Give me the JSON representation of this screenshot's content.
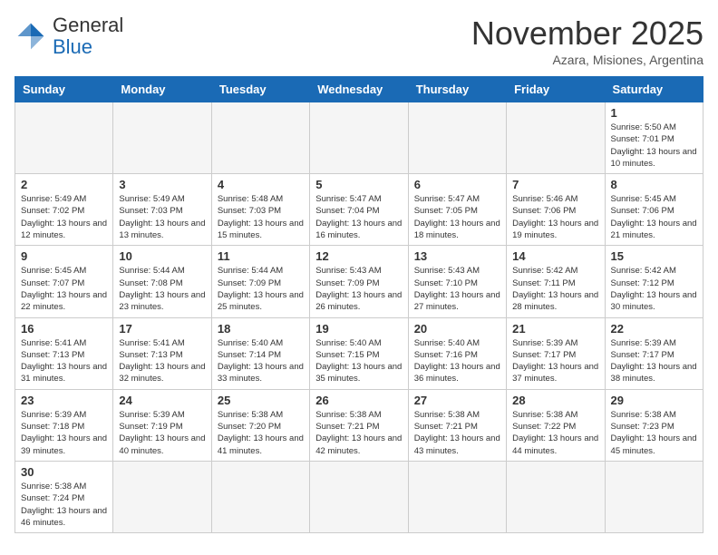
{
  "header": {
    "logo_general": "General",
    "logo_blue": "Blue",
    "month_title": "November 2025",
    "subtitle": "Azara, Misiones, Argentina"
  },
  "days_of_week": [
    "Sunday",
    "Monday",
    "Tuesday",
    "Wednesday",
    "Thursday",
    "Friday",
    "Saturday"
  ],
  "weeks": [
    [
      {
        "day": "",
        "info": ""
      },
      {
        "day": "",
        "info": ""
      },
      {
        "day": "",
        "info": ""
      },
      {
        "day": "",
        "info": ""
      },
      {
        "day": "",
        "info": ""
      },
      {
        "day": "",
        "info": ""
      },
      {
        "day": "1",
        "info": "Sunrise: 5:50 AM\nSunset: 7:01 PM\nDaylight: 13 hours and 10 minutes."
      }
    ],
    [
      {
        "day": "2",
        "info": "Sunrise: 5:49 AM\nSunset: 7:02 PM\nDaylight: 13 hours and 12 minutes."
      },
      {
        "day": "3",
        "info": "Sunrise: 5:49 AM\nSunset: 7:03 PM\nDaylight: 13 hours and 13 minutes."
      },
      {
        "day": "4",
        "info": "Sunrise: 5:48 AM\nSunset: 7:03 PM\nDaylight: 13 hours and 15 minutes."
      },
      {
        "day": "5",
        "info": "Sunrise: 5:47 AM\nSunset: 7:04 PM\nDaylight: 13 hours and 16 minutes."
      },
      {
        "day": "6",
        "info": "Sunrise: 5:47 AM\nSunset: 7:05 PM\nDaylight: 13 hours and 18 minutes."
      },
      {
        "day": "7",
        "info": "Sunrise: 5:46 AM\nSunset: 7:06 PM\nDaylight: 13 hours and 19 minutes."
      },
      {
        "day": "8",
        "info": "Sunrise: 5:45 AM\nSunset: 7:06 PM\nDaylight: 13 hours and 21 minutes."
      }
    ],
    [
      {
        "day": "9",
        "info": "Sunrise: 5:45 AM\nSunset: 7:07 PM\nDaylight: 13 hours and 22 minutes."
      },
      {
        "day": "10",
        "info": "Sunrise: 5:44 AM\nSunset: 7:08 PM\nDaylight: 13 hours and 23 minutes."
      },
      {
        "day": "11",
        "info": "Sunrise: 5:44 AM\nSunset: 7:09 PM\nDaylight: 13 hours and 25 minutes."
      },
      {
        "day": "12",
        "info": "Sunrise: 5:43 AM\nSunset: 7:09 PM\nDaylight: 13 hours and 26 minutes."
      },
      {
        "day": "13",
        "info": "Sunrise: 5:43 AM\nSunset: 7:10 PM\nDaylight: 13 hours and 27 minutes."
      },
      {
        "day": "14",
        "info": "Sunrise: 5:42 AM\nSunset: 7:11 PM\nDaylight: 13 hours and 28 minutes."
      },
      {
        "day": "15",
        "info": "Sunrise: 5:42 AM\nSunset: 7:12 PM\nDaylight: 13 hours and 30 minutes."
      }
    ],
    [
      {
        "day": "16",
        "info": "Sunrise: 5:41 AM\nSunset: 7:13 PM\nDaylight: 13 hours and 31 minutes."
      },
      {
        "day": "17",
        "info": "Sunrise: 5:41 AM\nSunset: 7:13 PM\nDaylight: 13 hours and 32 minutes."
      },
      {
        "day": "18",
        "info": "Sunrise: 5:40 AM\nSunset: 7:14 PM\nDaylight: 13 hours and 33 minutes."
      },
      {
        "day": "19",
        "info": "Sunrise: 5:40 AM\nSunset: 7:15 PM\nDaylight: 13 hours and 35 minutes."
      },
      {
        "day": "20",
        "info": "Sunrise: 5:40 AM\nSunset: 7:16 PM\nDaylight: 13 hours and 36 minutes."
      },
      {
        "day": "21",
        "info": "Sunrise: 5:39 AM\nSunset: 7:17 PM\nDaylight: 13 hours and 37 minutes."
      },
      {
        "day": "22",
        "info": "Sunrise: 5:39 AM\nSunset: 7:17 PM\nDaylight: 13 hours and 38 minutes."
      }
    ],
    [
      {
        "day": "23",
        "info": "Sunrise: 5:39 AM\nSunset: 7:18 PM\nDaylight: 13 hours and 39 minutes."
      },
      {
        "day": "24",
        "info": "Sunrise: 5:39 AM\nSunset: 7:19 PM\nDaylight: 13 hours and 40 minutes."
      },
      {
        "day": "25",
        "info": "Sunrise: 5:38 AM\nSunset: 7:20 PM\nDaylight: 13 hours and 41 minutes."
      },
      {
        "day": "26",
        "info": "Sunrise: 5:38 AM\nSunset: 7:21 PM\nDaylight: 13 hours and 42 minutes."
      },
      {
        "day": "27",
        "info": "Sunrise: 5:38 AM\nSunset: 7:21 PM\nDaylight: 13 hours and 43 minutes."
      },
      {
        "day": "28",
        "info": "Sunrise: 5:38 AM\nSunset: 7:22 PM\nDaylight: 13 hours and 44 minutes."
      },
      {
        "day": "29",
        "info": "Sunrise: 5:38 AM\nSunset: 7:23 PM\nDaylight: 13 hours and 45 minutes."
      }
    ],
    [
      {
        "day": "30",
        "info": "Sunrise: 5:38 AM\nSunset: 7:24 PM\nDaylight: 13 hours and 46 minutes."
      },
      {
        "day": "",
        "info": ""
      },
      {
        "day": "",
        "info": ""
      },
      {
        "day": "",
        "info": ""
      },
      {
        "day": "",
        "info": ""
      },
      {
        "day": "",
        "info": ""
      },
      {
        "day": "",
        "info": ""
      }
    ]
  ]
}
